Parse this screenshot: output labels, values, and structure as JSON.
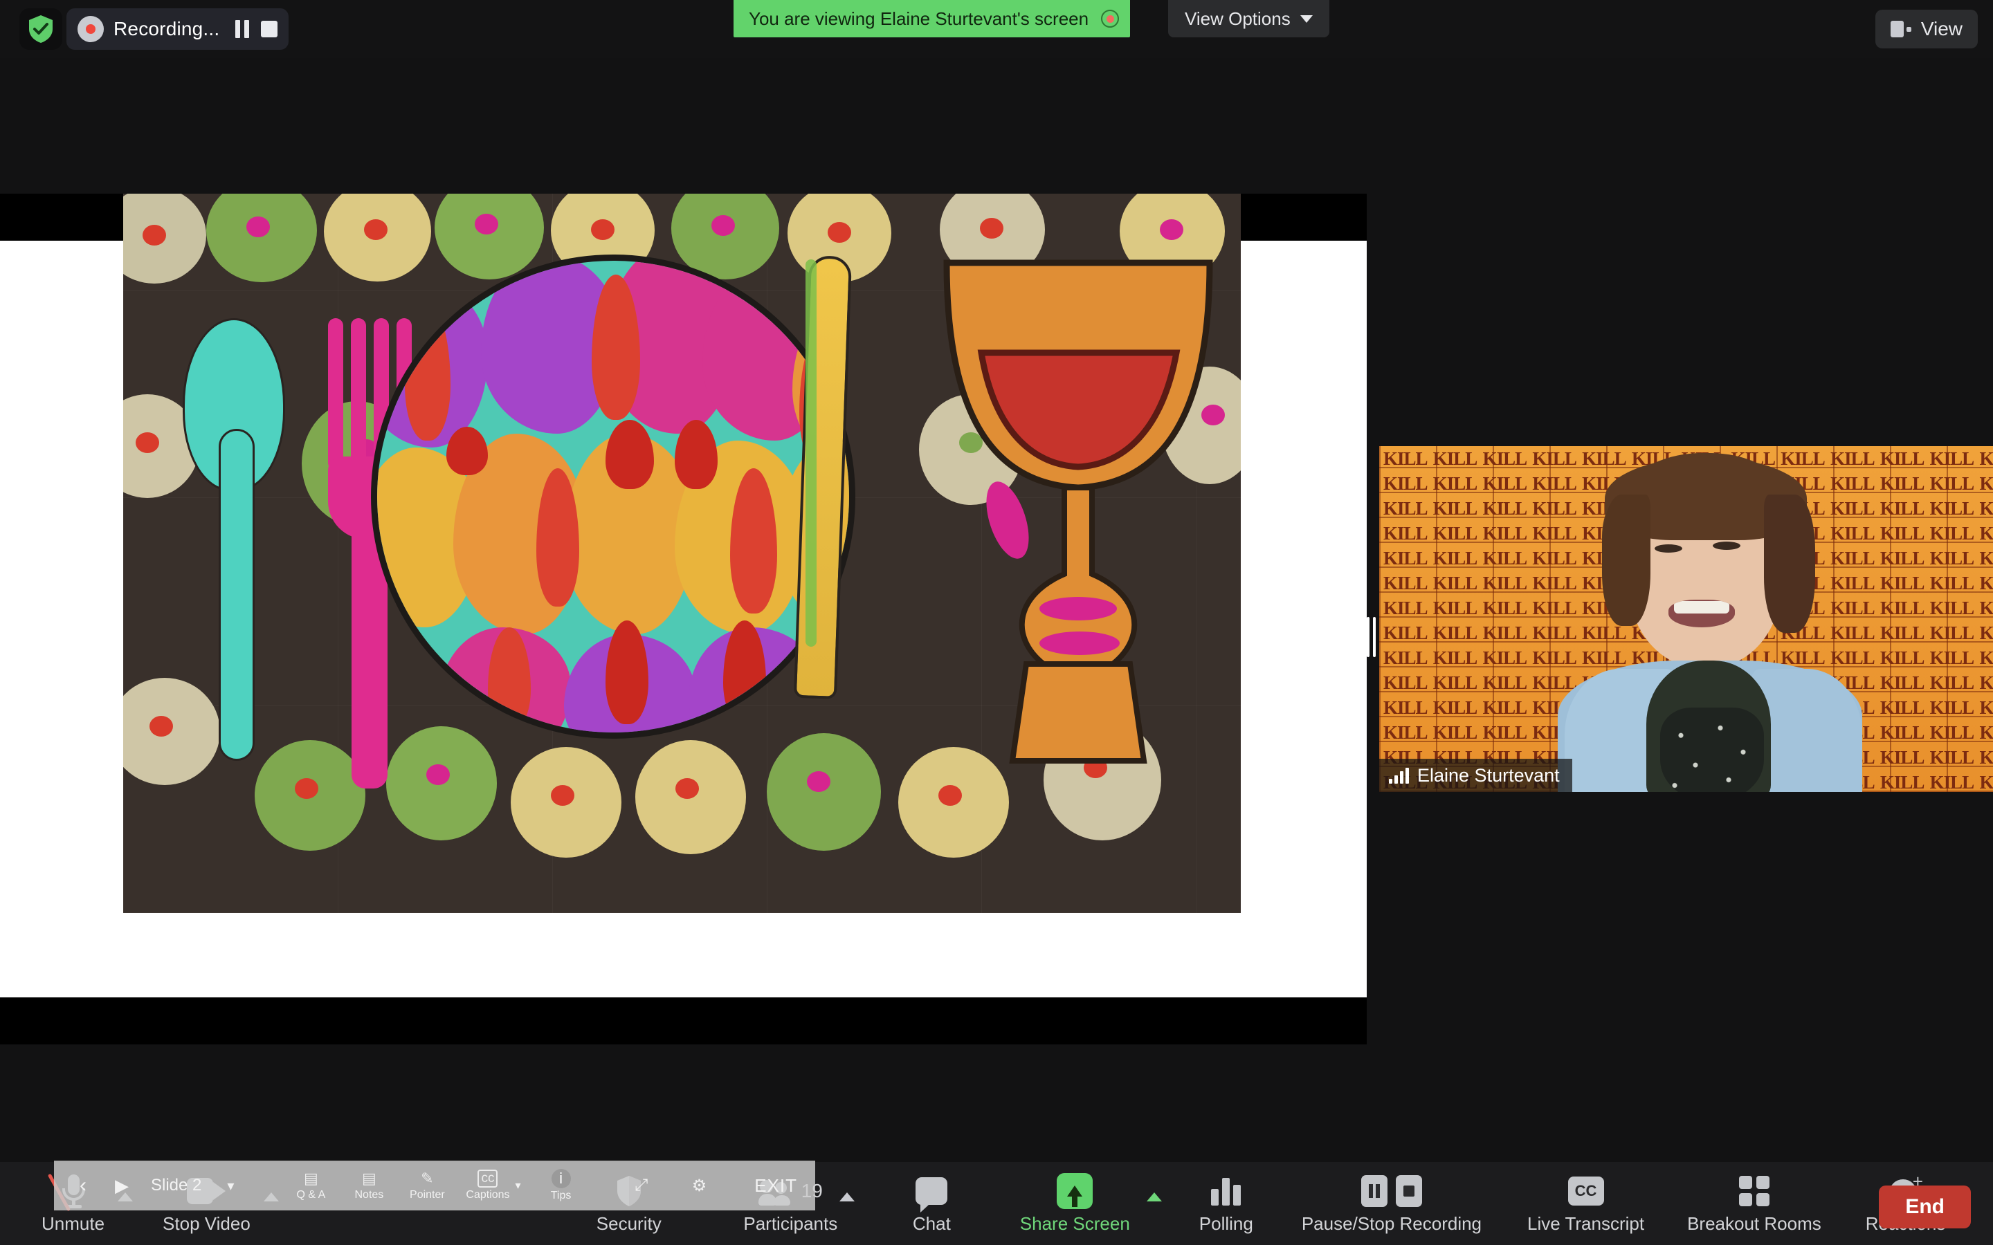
{
  "topbar": {
    "shield_icon": "security-shield-icon",
    "recording": {
      "label": "Recording...",
      "record_dot_icon": "record-dot-icon",
      "pause_icon": "pause-icon",
      "stop_icon": "stop-icon"
    },
    "share_banner": {
      "text": "You are viewing Elaine Sturtevant's screen",
      "recording_indicator_icon": "recording-indicator-icon",
      "color": "#62d36b"
    },
    "view_options": {
      "label": "View Options",
      "chevron_icon": "chevron-down-icon"
    },
    "view_button": {
      "label": "View",
      "icon": "layout-icon"
    }
  },
  "shared_screen": {
    "slideshow": {
      "prev_icon": "previous-slide-icon",
      "next_icon": "next-slide-icon",
      "slide_label": "Slide 2",
      "slide_dropdown_icon": "chevron-down-icon",
      "items": [
        {
          "label": "Q & A",
          "icon": "qa-icon"
        },
        {
          "label": "Notes",
          "icon": "notes-icon"
        },
        {
          "label": "Pointer",
          "icon": "pointer-icon"
        },
        {
          "label": "Captions",
          "icon": "captions-icon"
        },
        {
          "label": "Tips",
          "icon": "tips-info-icon"
        }
      ],
      "fullscreen_icon": "fullscreen-icon",
      "settings_icon": "settings-gear-icon",
      "exit_label": "EXIT"
    },
    "resize_handle_icon": "resize-handle-icon"
  },
  "participant_video": {
    "name": "Elaine Sturtevant",
    "audio_icon": "audio-level-bars-icon",
    "background_text": "KILL"
  },
  "toolbar": {
    "items": [
      {
        "label": "Unmute",
        "icon": "microphone-muted-icon",
        "caret": true
      },
      {
        "label": "Stop Video",
        "icon": "camera-icon",
        "caret": true
      },
      {
        "label": "Security",
        "icon": "shield-icon",
        "caret": false
      },
      {
        "label": "Participants",
        "icon": "people-icon",
        "caret": true,
        "count": "19"
      },
      {
        "label": "Chat",
        "icon": "chat-bubble-icon",
        "caret": false
      },
      {
        "label": "Share Screen",
        "icon": "share-screen-icon",
        "caret": true,
        "accent": "#6fd77a"
      },
      {
        "label": "Polling",
        "icon": "poll-bars-icon",
        "caret": false
      },
      {
        "label": "Pause/Stop Recording",
        "icon": "pause-stop-recording-icon",
        "caret": false
      },
      {
        "label": "Live Transcript",
        "icon": "closed-captions-icon",
        "caret": false
      },
      {
        "label": "Breakout Rooms",
        "icon": "breakout-rooms-icon",
        "caret": false
      },
      {
        "label": "Reactions",
        "icon": "reactions-smiley-icon",
        "caret": false
      }
    ],
    "end_button": {
      "label": "End",
      "color": "#c0392f"
    }
  }
}
